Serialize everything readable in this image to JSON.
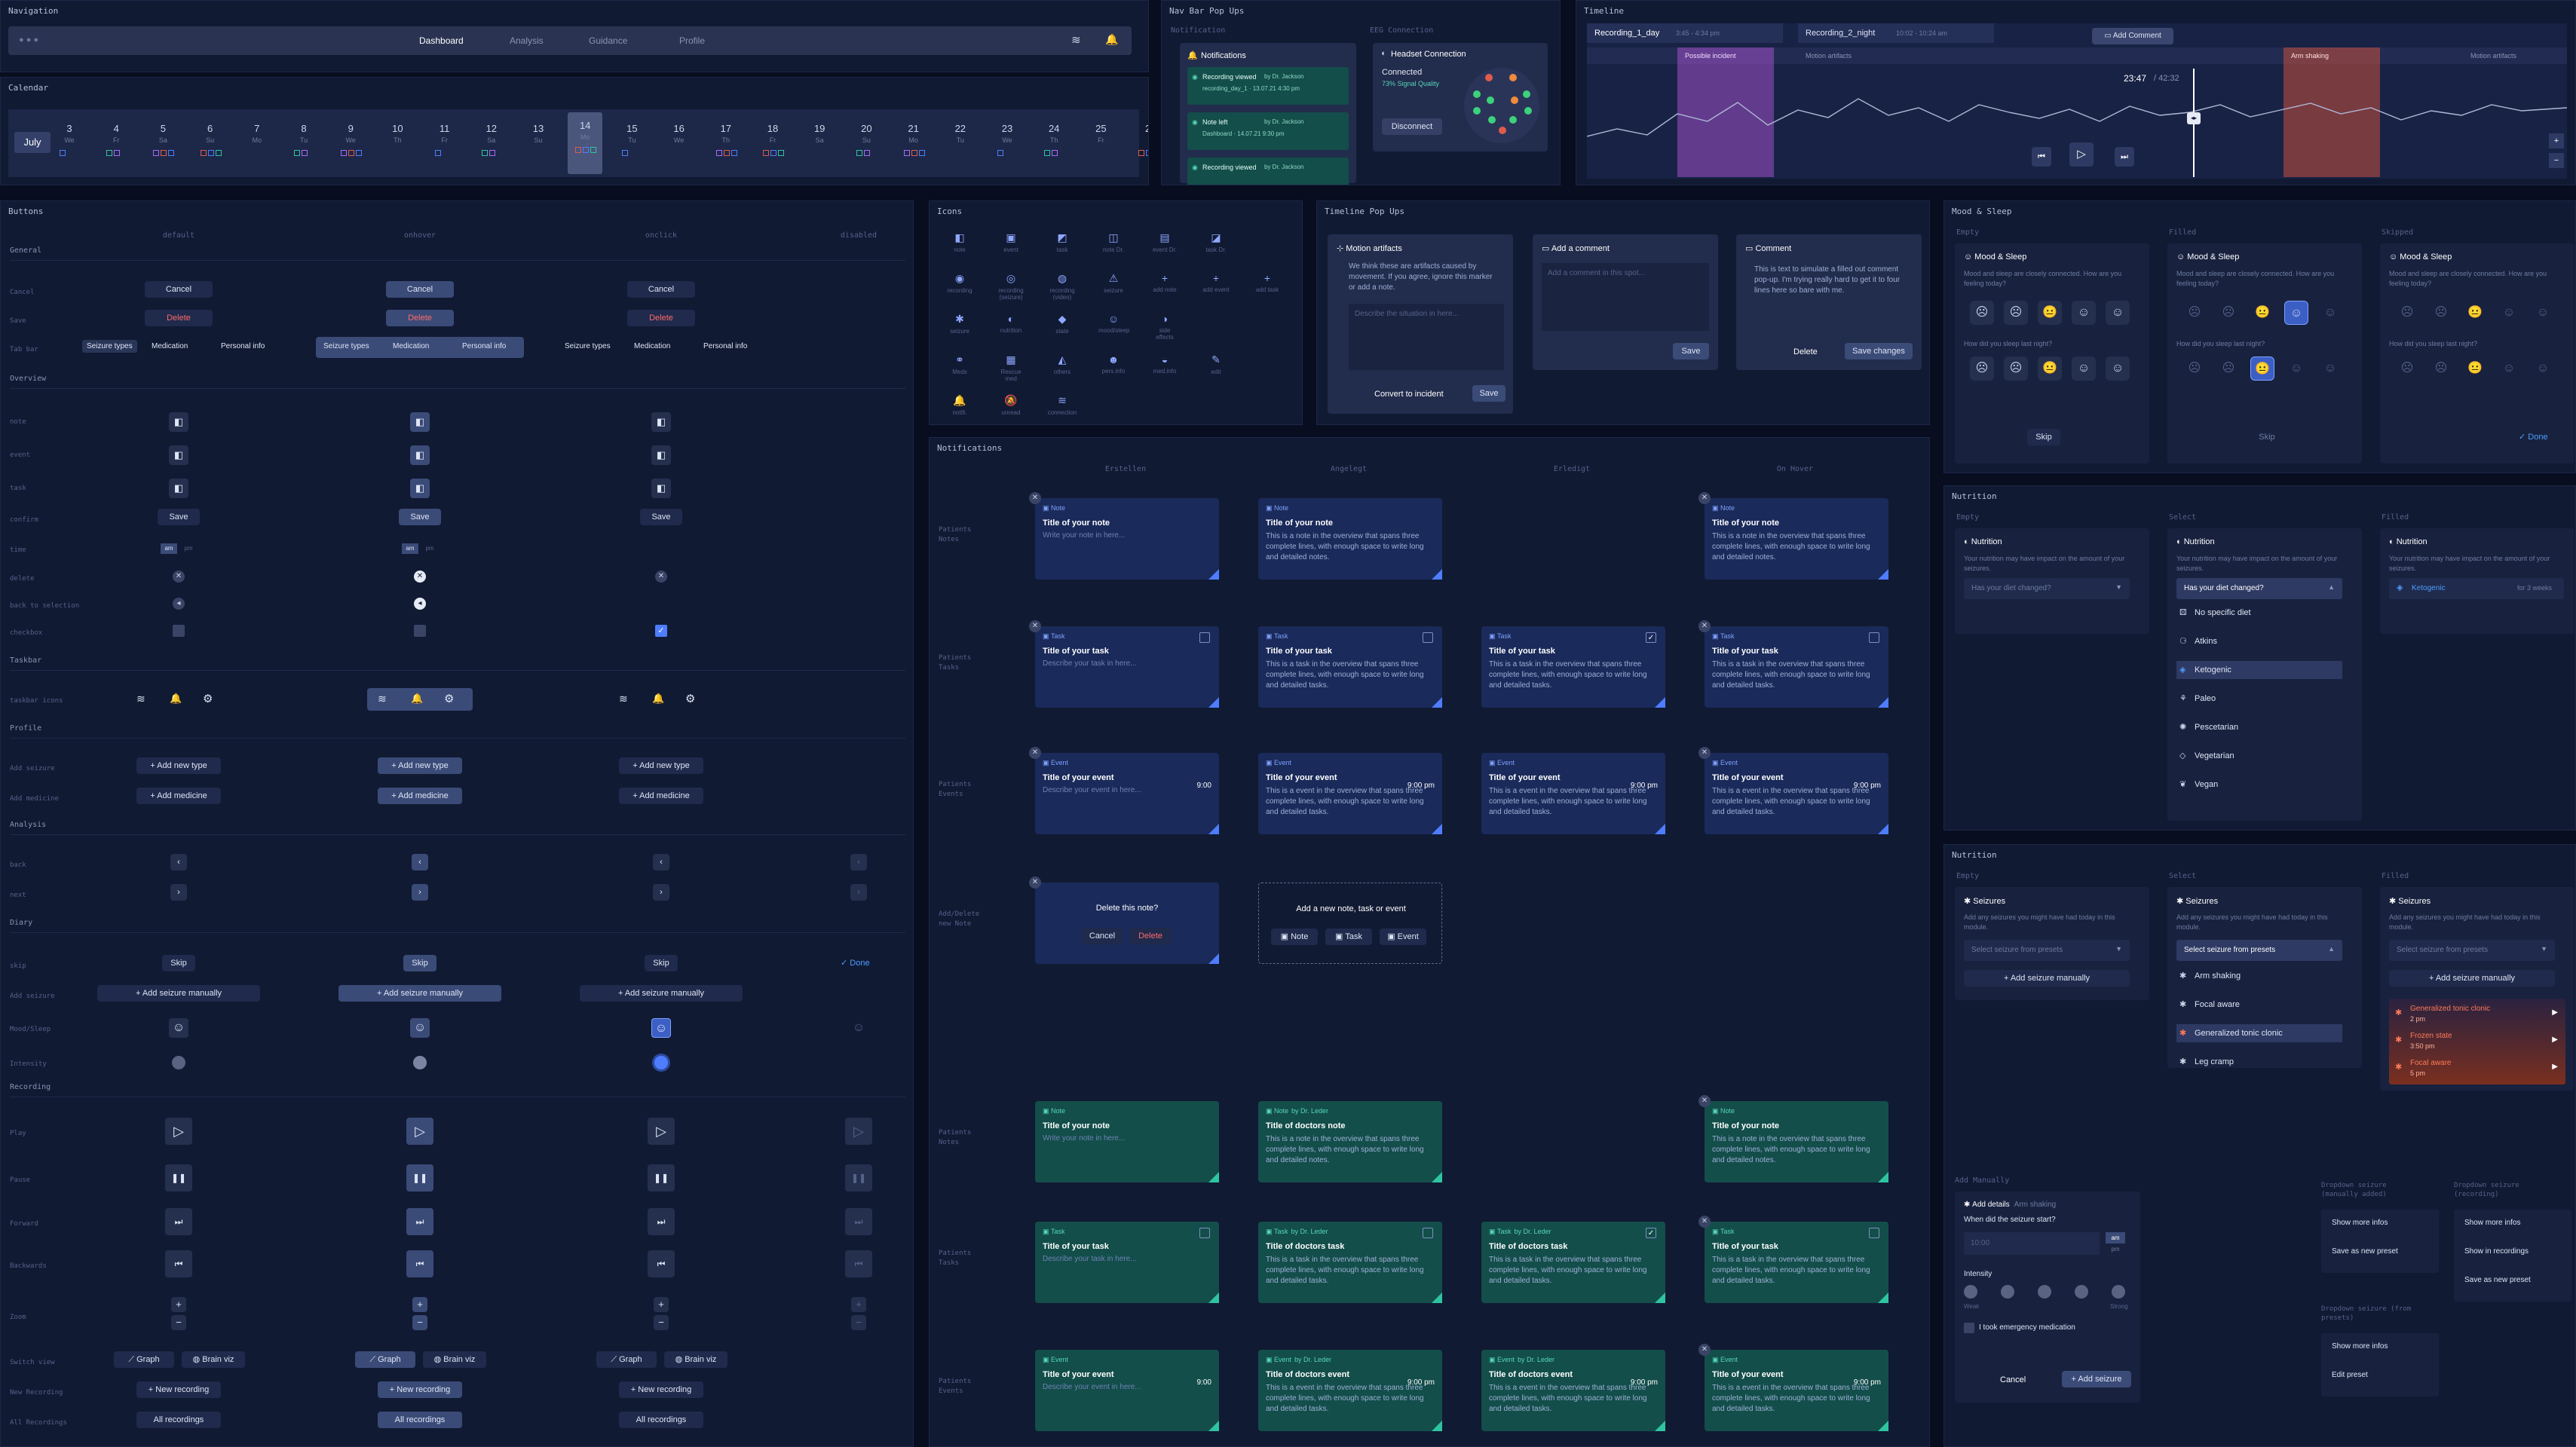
{
  "nav": {
    "title": "Navigation",
    "items": [
      "Dashboard",
      "Analysis",
      "Guidance",
      "Profile"
    ]
  },
  "calendar": {
    "title": "Calendar",
    "month": "July",
    "days": [
      {
        "n": "3",
        "d": "We"
      },
      {
        "n": "4",
        "d": "Fr"
      },
      {
        "n": "5",
        "d": "Sa"
      },
      {
        "n": "6",
        "d": "Su"
      },
      {
        "n": "7",
        "d": "Mo"
      },
      {
        "n": "8",
        "d": "Tu"
      },
      {
        "n": "9",
        "d": "We"
      },
      {
        "n": "10",
        "d": "Th"
      },
      {
        "n": "11",
        "d": "Fr"
      },
      {
        "n": "12",
        "d": "Sa"
      },
      {
        "n": "13",
        "d": "Su"
      },
      {
        "n": "14",
        "d": "Mo"
      },
      {
        "n": "15",
        "d": "Tu"
      },
      {
        "n": "16",
        "d": "We"
      },
      {
        "n": "17",
        "d": "Th"
      },
      {
        "n": "18",
        "d": "Fr"
      },
      {
        "n": "19",
        "d": "Sa"
      },
      {
        "n": "20",
        "d": "Su"
      },
      {
        "n": "21",
        "d": "Mo"
      },
      {
        "n": "22",
        "d": "Tu"
      },
      {
        "n": "23",
        "d": "We"
      },
      {
        "n": "24",
        "d": "Th"
      },
      {
        "n": "25",
        "d": "Fr"
      },
      {
        "n": "2",
        "d": ""
      }
    ]
  },
  "navbar_popups": {
    "title": "Nav Bar Pop Ups",
    "notification_label": "Notification",
    "eeg_label": "EEG Connection",
    "notifications_title": "Notifications",
    "notifs": [
      {
        "t": "Recording viewed",
        "by": "by Dr. Jackson",
        "s": "recording_day_1 · 13.07.21 4:30 pm"
      },
      {
        "t": "Note left",
        "by": "by Dr. Jackson",
        "s": "Dashboard · 14.07.21 9:30 pm"
      },
      {
        "t": "Recording viewed",
        "by": "by Dr. Jackson",
        "s": ""
      }
    ],
    "headset_title": "Headset Connection",
    "connected": "Connected",
    "signal": "73% Signal Quality",
    "disconnect": "Disconnect"
  },
  "timeline": {
    "title": "Timeline",
    "rec1": "Recording_1_day",
    "rec1_time": "3:45 - 4:34 pm",
    "rec2": "Recording_2_night",
    "rec2_time": "10:02 - 10:24 am",
    "add_comment": "Add Comment",
    "markers": [
      "Possible incident",
      "Motion artifacts",
      "Arm shaking",
      "Motion artifacts"
    ],
    "time": "23:47",
    "total": "/ 42:32"
  },
  "buttons": {
    "title": "Buttons",
    "states": [
      "default",
      "onhover",
      "onclick",
      "disabled"
    ],
    "sections": {
      "general": "General",
      "overview": "Overview",
      "taskbar": "Taskbar",
      "profile": "Profile",
      "analysis": "Analysis",
      "diary": "Diary",
      "recording": "Recording"
    },
    "rows": {
      "cancel": "Cancel",
      "save": "Save",
      "tab_bar": "Tab bar",
      "note": "note",
      "event": "event",
      "task": "task",
      "confirm": "confirm",
      "time": "time",
      "delete": "delete",
      "back_to_selection": "back to selection",
      "checkbox": "checkbox",
      "taskbar_icons": "taskbar icons",
      "add_seizure": "Add seizure",
      "add_medicine": "Add medicine",
      "back": "back",
      "next": "next",
      "skip": "skip",
      "add_seizure2": "Add seizure",
      "mood_sleep": "Mood/Sleep",
      "intensity": "Intensity",
      "play": "Play",
      "pause": "Pause",
      "forward": "Forward",
      "backwards": "Backwards",
      "zoom": "Zoom",
      "switch_view": "Switch view",
      "new_recording": "New Recording",
      "all_recordings": "All Recordings"
    },
    "cancel_label": "Cancel",
    "delete_label": "Delete",
    "tabs": [
      "Seizure types",
      "Medication",
      "Personal info"
    ],
    "save_label": "Save",
    "am": "am",
    "pm": "pm",
    "add_new_type": "+  Add new type",
    "add_medicine_label": "+  Add medicine",
    "skip_label": "Skip",
    "done_label": "✓ Done",
    "add_seizure_manually": "+  Add seizure manually",
    "graph": "Graph",
    "brain": "Brain viz",
    "new_recording_label": "+  New recording",
    "all_recordings_label": "All recordings"
  },
  "icons": {
    "title": "Icons",
    "items": [
      {
        "g": "◧",
        "n": "note"
      },
      {
        "g": "▣",
        "n": "event"
      },
      {
        "g": "◩",
        "n": "task"
      },
      {
        "g": "◫",
        "n": "note Dr."
      },
      {
        "g": "▤",
        "n": "event Dr."
      },
      {
        "g": "◪",
        "n": "task Dr."
      },
      {
        "g": "",
        "n": ""
      },
      {
        "g": "◉",
        "n": "recording"
      },
      {
        "g": "◎",
        "n": "recording (seizure)"
      },
      {
        "g": "◍",
        "n": "recording (video)"
      },
      {
        "g": "⚠",
        "n": "seizure"
      },
      {
        "g": "+",
        "n": "add note"
      },
      {
        "g": "+",
        "n": "add event"
      },
      {
        "g": "+",
        "n": "add task"
      },
      {
        "g": "✱",
        "n": "seizure"
      },
      {
        "g": "◐",
        "n": "nutrition"
      },
      {
        "g": "◆",
        "n": "state"
      },
      {
        "g": "☺",
        "n": "mood/sleep"
      },
      {
        "g": "◑",
        "n": "side effects"
      },
      {
        "g": "",
        "n": ""
      },
      {
        "g": "",
        "n": ""
      },
      {
        "g": "⚭",
        "n": "Meds"
      },
      {
        "g": "▦",
        "n": "Rescue med"
      },
      {
        "g": "◭",
        "n": "others"
      },
      {
        "g": "☻",
        "n": "pers.info"
      },
      {
        "g": "◒",
        "n": "med.info"
      },
      {
        "g": "✎",
        "n": "edit"
      },
      {
        "g": "",
        "n": ""
      },
      {
        "g": "🔔",
        "n": "notifi."
      },
      {
        "g": "🔕",
        "n": "unread"
      },
      {
        "g": "≋",
        "n": "connection"
      }
    ]
  },
  "timeline_popups": {
    "title": "Timeline Pop Ups",
    "motion_title": "Motion artifacts",
    "motion_text": "We think these are artifacts caused by movement. If you agree, ignore this marker or add a note.",
    "motion_ph": "Describe the situation in here...",
    "convert": "Convert to incident",
    "save": "Save",
    "add_comment": "Add a comment",
    "comment_ph": "Add a comment in this spot...",
    "comment": "Comment",
    "comment_text": "This is text to simulate a filled out comment pop-up. I'm trying really hard to get it to four lines here so bare with me.",
    "delete": "Delete",
    "save_changes": "Save changes"
  },
  "notifications": {
    "title": "Notifications",
    "cols": [
      "Erstellen",
      "Angelegt",
      "Erledigt",
      "On Hover"
    ],
    "rows": [
      "Patients Notes",
      "Patients Tasks",
      "Patients Events",
      "Add/Delete new Note",
      "Patients Notes",
      "Patients Tasks",
      "Patients Events"
    ],
    "note": "Note",
    "task": "Task",
    "event": "Event",
    "note_dr": "Note",
    "task_dr": "Task",
    "event_dr": "Event",
    "by_dr": "by Dr. Leder",
    "title_note": "Title of your note",
    "title_task": "Title of your task",
    "title_event": "Title of your event",
    "title_dr_note": "Title of doctors note",
    "title_dr_task": "Title of doctors task",
    "title_dr_event": "Title of doctors event",
    "ph_note": "Write your note in here...",
    "ph_task": "Describe your task in here...",
    "ph_event": "Describe your event in here...",
    "body_note": "This is a note in the overview that spans three complete lines, with enough space to write long and detailed notes.",
    "body_task": "This is a task in the overview that spans three complete lines, with enough space to write long and detailed tasks.",
    "body_event": "This is a event in the overview that spans three complete lines, with enough space to write long and detailed tasks.",
    "time": "9:00 pm",
    "time_short": "9:00",
    "delete_q": "Delete this note?",
    "cancel": "Cancel",
    "delete": "Delete",
    "add_new": "Add a new note, task or event",
    "add_btns": [
      "Note",
      "Task",
      "Event"
    ]
  },
  "mood": {
    "title": "Mood & Sleep",
    "cols": [
      "Empty",
      "Filled",
      "Skipped"
    ],
    "card_title": "Mood & Sleep",
    "q1": "Mood and sleep are closely connected. How are you feeling today?",
    "q2": "How did you sleep last night?",
    "faces": [
      "☹",
      "☹",
      "😐",
      "☺",
      "☺"
    ],
    "skip": "Skip",
    "done": "✓ Done"
  },
  "nutrition": {
    "title": "Nutrition",
    "cols": [
      "Empty",
      "Select",
      "Filled"
    ],
    "card_title": "Nutrition",
    "desc": "Your nutrition may have impact on the amount of your seizures.",
    "select_ph": "Has your diet changed?",
    "options": [
      "No specific diet",
      "Atkins",
      "Ketogenic",
      "Paleo",
      "Pescetarian",
      "Vegetarian",
      "Vegan"
    ],
    "filled": "Ketogenic",
    "filled_time": "for 3 weeks"
  },
  "seizures": {
    "title": "Nutrition",
    "cols": [
      "Empty",
      "Select",
      "Filled"
    ],
    "card_title": "Seizures",
    "desc": "Add any seizures you might have had today in this module.",
    "select_ph": "Select seizure from presets",
    "add_manual": "+  Add seizure manually",
    "options": [
      "Arm shaking",
      "Focal aware",
      "Generalized tonic clonic",
      "Leg cramp"
    ],
    "filled": [
      {
        "n": "Generalized tonic clonic",
        "t": "2 pm"
      },
      {
        "n": "Frozen state",
        "t": "3:50 pm"
      },
      {
        "n": "Focal aware",
        "t": "5 pm"
      }
    ],
    "add_manually_label": "Add Manually",
    "add_details": "Add details",
    "arm_shaking": "Arm shaking",
    "when": "When did the seizure start?",
    "time_ph": "10:00",
    "am": "am",
    "pm": "pm",
    "intensity": "Intensity",
    "weak": "Weak",
    "strong": "Strong",
    "emergency": "I took emergency medication",
    "cancel": "Cancel",
    "add_seizure": "+  Add seizure",
    "dd1_label": "Dropdown seizure (manually added)",
    "dd1": [
      "Show more infos",
      "Save as new preset"
    ],
    "dd2_label": "Dropdown seizure (recording)",
    "dd2": [
      "Show more infos",
      "Show in recordings",
      "Save as new preset"
    ],
    "dd3_label": "Dropdown seizure (from presets)",
    "dd3": [
      "Show more infos",
      "Edit preset"
    ]
  }
}
